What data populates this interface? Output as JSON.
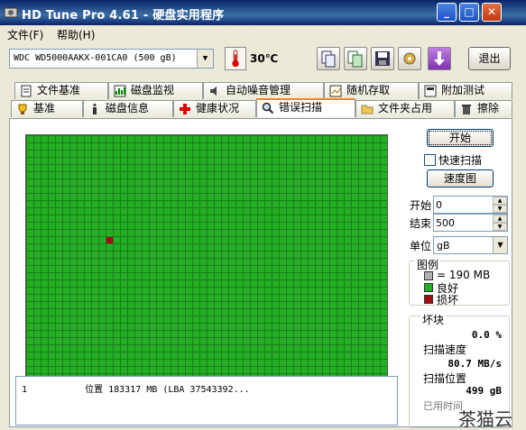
{
  "window": {
    "title": "HD Tune Pro 4.61 - 硬盘实用程序",
    "minimize": "_",
    "maximize": "□",
    "close": "✕"
  },
  "menu": [
    {
      "label": "文件(F)"
    },
    {
      "label": "帮助(H)"
    }
  ],
  "toolbar": {
    "drive": "WDC WD5000AAKX-001CA0 (500 gB)",
    "temperature": "30℃",
    "exit_label": "退出",
    "icons": [
      "copy-info-icon",
      "copy-screenshot-icon",
      "save-icon",
      "options-icon",
      "download-icon"
    ]
  },
  "tabs_top": [
    {
      "label": "文件基准",
      "icon": "file-benchmark-icon"
    },
    {
      "label": "磁盘监视",
      "icon": "disk-monitor-icon"
    },
    {
      "label": "自动噪音管理",
      "icon": "speaker-icon"
    },
    {
      "label": "随机存取",
      "icon": "random-access-icon"
    },
    {
      "label": "附加测试",
      "icon": "extra-tests-icon"
    }
  ],
  "tabs_bottom": [
    {
      "label": "基准",
      "icon": "benchmark-icon"
    },
    {
      "label": "磁盘信息",
      "icon": "disk-info-icon"
    },
    {
      "label": "健康状况",
      "icon": "health-icon"
    },
    {
      "label": "错误扫描",
      "icon": "error-scan-icon",
      "active": true
    },
    {
      "label": "文件夹占用",
      "icon": "folder-icon"
    },
    {
      "label": "擦除",
      "icon": "erase-icon"
    }
  ],
  "scan": {
    "start_button": "开始",
    "quick_scan_label": "快速扫描",
    "quick_scan_checked": false,
    "speed_map_button": "速度图",
    "start_label": "开始",
    "start_value": "0",
    "end_label": "结束",
    "end_value": "500",
    "unit_label": "单位",
    "unit_value": "gB",
    "legend_title": "图例",
    "legend_block": "= 190 MB",
    "legend_good": "良好",
    "legend_bad": "损坏",
    "damaged_title": "坏块",
    "damaged_value": "0.0 %",
    "speed_title": "扫描速度",
    "speed_value": "80.7 MB/s",
    "position_title": "扫描位置",
    "position_value": "499 gB",
    "elapsed_title": "已用时间",
    "log": [
      {
        "index": "1",
        "text": "位置 183317 MB (LBA 37543392..."
      }
    ],
    "colors": {
      "good": "#22b022",
      "bad": "#a01010",
      "grid_line": "#1f7a1f",
      "block": "#b0b0b0"
    },
    "bad_block_row": 0.4,
    "bad_block_col": 0.21
  },
  "watermark": "茶猫云"
}
